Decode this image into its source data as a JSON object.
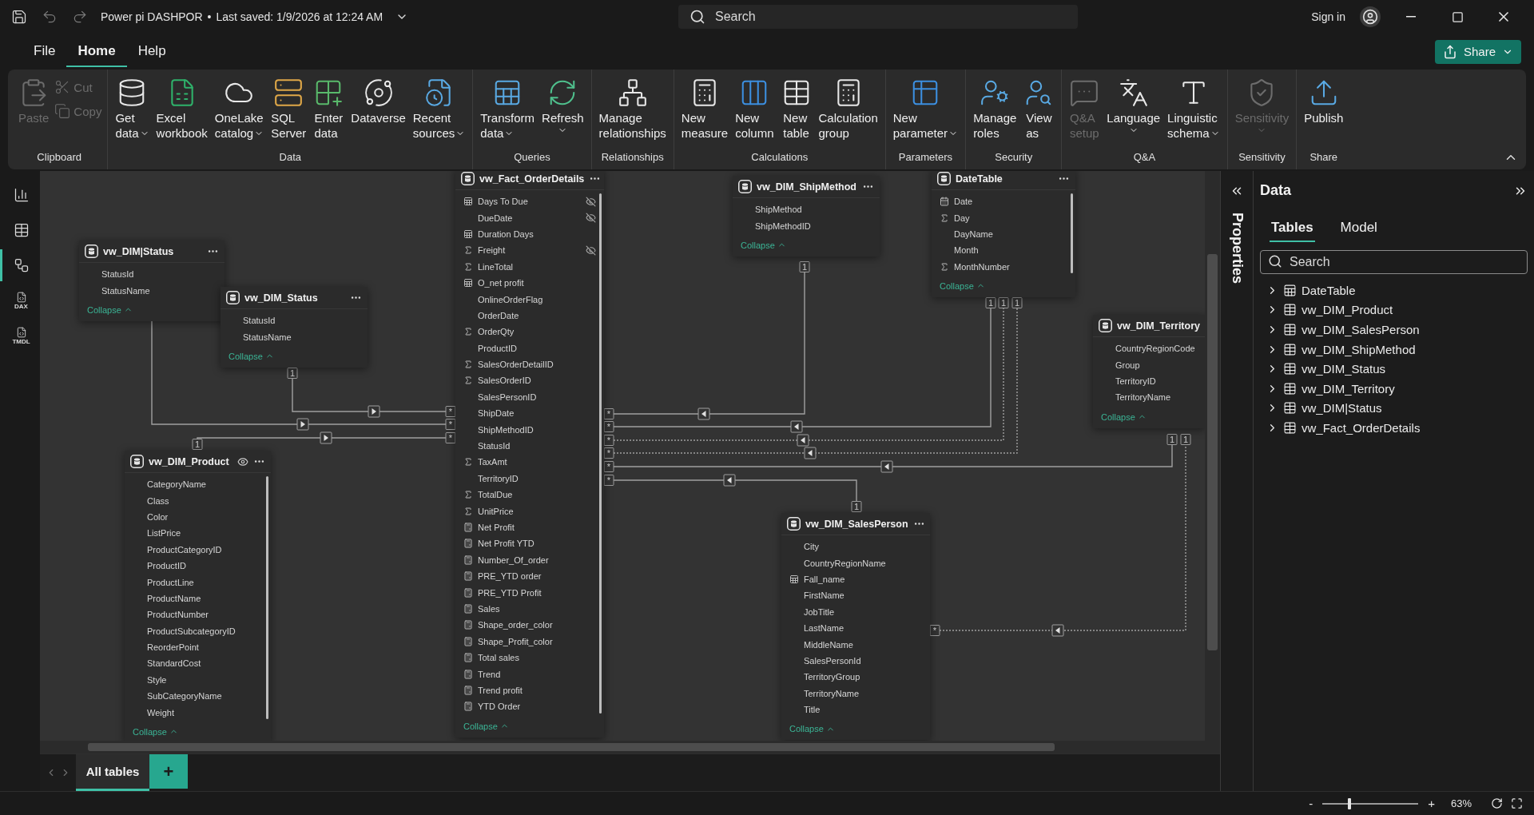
{
  "title_bar": {
    "title": "Power pi DASHPOR",
    "separator": "•",
    "saved": "Last saved: 1/9/2026 at 12:24 AM",
    "search": {
      "placeholder": "Search"
    },
    "sign_in": "Sign in"
  },
  "menu": {
    "items": [
      {
        "label": "File",
        "selected": false
      },
      {
        "label": "Home",
        "selected": true
      },
      {
        "label": "Help",
        "selected": false
      }
    ],
    "share": "Share"
  },
  "ribbon": {
    "groups": [
      {
        "label": "Clipboard",
        "buttons": [
          {
            "kind": "large",
            "lines": [
              "Paste"
            ],
            "dropdown": false,
            "disabled": true
          },
          {
            "kind": "small",
            "lines": [
              "Cut"
            ],
            "dropdown": false,
            "disabled": true
          },
          {
            "kind": "small",
            "lines": [
              "Copy"
            ],
            "dropdown": false,
            "disabled": true
          }
        ]
      },
      {
        "label": "Data",
        "buttons": [
          {
            "kind": "large",
            "lines": [
              "Get",
              "data"
            ],
            "dropdown": true,
            "disabled": false
          },
          {
            "kind": "large",
            "lines": [
              "Excel",
              "workbook"
            ],
            "dropdown": false,
            "disabled": false
          },
          {
            "kind": "large",
            "lines": [
              "OneLake",
              "catalog"
            ],
            "dropdown": true,
            "disabled": false
          },
          {
            "kind": "large",
            "lines": [
              "SQL",
              "Server"
            ],
            "dropdown": false,
            "disabled": false
          },
          {
            "kind": "large",
            "lines": [
              "Enter",
              "data"
            ],
            "dropdown": false,
            "disabled": false
          },
          {
            "kind": "large",
            "lines": [
              "Dataverse"
            ],
            "dropdown": false,
            "disabled": false
          },
          {
            "kind": "large",
            "lines": [
              "Recent",
              "sources"
            ],
            "dropdown": true,
            "disabled": false
          }
        ]
      },
      {
        "label": "Queries",
        "buttons": [
          {
            "kind": "large",
            "lines": [
              "Transform",
              "data"
            ],
            "dropdown": true,
            "disabled": false
          },
          {
            "kind": "large",
            "lines": [
              "Refresh"
            ],
            "dropdown": true,
            "disabled": false
          }
        ]
      },
      {
        "label": "Relationships",
        "buttons": [
          {
            "kind": "large",
            "lines": [
              "Manage",
              "relationships"
            ],
            "dropdown": false,
            "disabled": false
          }
        ]
      },
      {
        "label": "Calculations",
        "buttons": [
          {
            "kind": "large",
            "lines": [
              "New",
              "measure"
            ],
            "dropdown": false,
            "disabled": false
          },
          {
            "kind": "large",
            "lines": [
              "New",
              "column"
            ],
            "dropdown": false,
            "disabled": false
          },
          {
            "kind": "large",
            "lines": [
              "New",
              "table"
            ],
            "dropdown": false,
            "disabled": false
          },
          {
            "kind": "large",
            "lines": [
              "Calculation",
              "group"
            ],
            "dropdown": false,
            "disabled": false
          }
        ]
      },
      {
        "label": "Parameters",
        "buttons": [
          {
            "kind": "large",
            "lines": [
              "New",
              "parameter"
            ],
            "dropdown": true,
            "disabled": false
          }
        ]
      },
      {
        "label": "Security",
        "buttons": [
          {
            "kind": "large",
            "lines": [
              "Manage",
              "roles"
            ],
            "dropdown": false,
            "disabled": false
          },
          {
            "kind": "large",
            "lines": [
              "View",
              "as"
            ],
            "dropdown": false,
            "disabled": false
          }
        ]
      },
      {
        "label": "Q&A",
        "buttons": [
          {
            "kind": "large",
            "lines": [
              "Q&A",
              "setup"
            ],
            "dropdown": false,
            "disabled": true
          },
          {
            "kind": "large",
            "lines": [
              "Language"
            ],
            "dropdown": true,
            "disabled": false
          },
          {
            "kind": "large",
            "lines": [
              "Linguistic",
              "schema"
            ],
            "dropdown": true,
            "disabled": false
          }
        ]
      },
      {
        "label": "Sensitivity",
        "buttons": [
          {
            "kind": "large",
            "lines": [
              "Sensitivity"
            ],
            "dropdown": true,
            "disabled": true
          }
        ]
      },
      {
        "label": "Share",
        "buttons": [
          {
            "kind": "large",
            "lines": [
              "Publish"
            ],
            "dropdown": false,
            "disabled": false
          }
        ]
      }
    ]
  },
  "nav": [
    {
      "kind": "report",
      "selected": false
    },
    {
      "kind": "table",
      "selected": false
    },
    {
      "kind": "model",
      "selected": true
    },
    {
      "kind": "dax",
      "label": "DAX",
      "selected": false
    },
    {
      "kind": "tmdl",
      "label": "TMDL",
      "selected": false
    }
  ],
  "diagram": {
    "tables": [
      {
        "name": "vw_Fact_OrderDetails",
        "eye": false,
        "collapse": "Collapse",
        "fields": [
          {
            "name": "Days To Due",
            "kind": "calc_column",
            "hidden": true
          },
          {
            "name": "DueDate",
            "kind": "none",
            "hidden": true
          },
          {
            "name": "Duration Days",
            "kind": "calc_column",
            "hidden": false
          },
          {
            "name": "Freight",
            "kind": "sum",
            "hidden": true
          },
          {
            "name": "LineTotal",
            "kind": "sum",
            "hidden": false
          },
          {
            "name": "O_net profit",
            "kind": "calc_column",
            "hidden": false
          },
          {
            "name": "OnlineOrderFlag",
            "kind": "none",
            "hidden": false
          },
          {
            "name": "OrderDate",
            "kind": "none",
            "hidden": false
          },
          {
            "name": "OrderQty",
            "kind": "sum",
            "hidden": false
          },
          {
            "name": "ProductID",
            "kind": "none",
            "hidden": false
          },
          {
            "name": "SalesOrderDetailID",
            "kind": "sum",
            "hidden": false
          },
          {
            "name": "SalesOrderID",
            "kind": "sum",
            "hidden": false
          },
          {
            "name": "SalesPersonID",
            "kind": "none",
            "hidden": false
          },
          {
            "name": "ShipDate",
            "kind": "none",
            "hidden": false
          },
          {
            "name": "ShipMethodID",
            "kind": "none",
            "hidden": false
          },
          {
            "name": "StatusId",
            "kind": "none",
            "hidden": false
          },
          {
            "name": "TaxAmt",
            "kind": "sum",
            "hidden": false
          },
          {
            "name": "TerritoryID",
            "kind": "none",
            "hidden": false
          },
          {
            "name": "TotalDue",
            "kind": "sum",
            "hidden": false
          },
          {
            "name": "UnitPrice",
            "kind": "sum",
            "hidden": false
          },
          {
            "name": "Net Profit",
            "kind": "measure",
            "hidden": false
          },
          {
            "name": "Net Profit YTD",
            "kind": "measure",
            "hidden": false
          },
          {
            "name": "Number_Of_order",
            "kind": "measure",
            "hidden": false
          },
          {
            "name": "PRE_YTD order",
            "kind": "measure",
            "hidden": false
          },
          {
            "name": "PRE_YTD Profit",
            "kind": "measure",
            "hidden": false
          },
          {
            "name": "Sales",
            "kind": "measure",
            "hidden": false
          },
          {
            "name": "Shape_order_color",
            "kind": "measure",
            "hidden": false
          },
          {
            "name": "Shape_Profit_color",
            "kind": "measure",
            "hidden": false
          },
          {
            "name": "Total sales",
            "kind": "measure",
            "hidden": false
          },
          {
            "name": "Trend",
            "kind": "measure",
            "hidden": false
          },
          {
            "name": "Trend profit",
            "kind": "measure",
            "hidden": false
          },
          {
            "name": "YTD Order",
            "kind": "measure",
            "hidden": false
          }
        ]
      },
      {
        "name": "vw_DIM_ShipMethod",
        "eye": false,
        "collapse": "Collapse",
        "fields": [
          {
            "name": "ShipMethod",
            "kind": "none"
          },
          {
            "name": "ShipMethodID",
            "kind": "none"
          }
        ]
      },
      {
        "name": "DateTable",
        "eye": false,
        "collapse": "Collapse",
        "fields": [
          {
            "name": "Date",
            "kind": "date"
          },
          {
            "name": "Day",
            "kind": "sum"
          },
          {
            "name": "DayName",
            "kind": "none"
          },
          {
            "name": "Month",
            "kind": "none"
          },
          {
            "name": "MonthNumber",
            "kind": "sum"
          }
        ]
      },
      {
        "name": "vw_DIM|Status",
        "eye": false,
        "collapse": "Collapse",
        "fields": [
          {
            "name": "StatusId",
            "kind": "none"
          },
          {
            "name": "StatusName",
            "kind": "none"
          }
        ]
      },
      {
        "name": "vw_DIM_Status",
        "eye": false,
        "collapse": "Collapse",
        "fields": [
          {
            "name": "StatusId",
            "kind": "none"
          },
          {
            "name": "StatusName",
            "kind": "none"
          }
        ]
      },
      {
        "name": "vw_DIM_Territory",
        "eye": false,
        "collapse": "Collapse",
        "fields": [
          {
            "name": "CountryRegionCode",
            "kind": "none"
          },
          {
            "name": "Group",
            "kind": "none"
          },
          {
            "name": "TerritoryID",
            "kind": "none"
          },
          {
            "name": "TerritoryName",
            "kind": "none"
          }
        ]
      },
      {
        "name": "vw_DIM_Product",
        "eye": true,
        "collapse": "Collapse",
        "fields": [
          {
            "name": "CategoryName",
            "kind": "none"
          },
          {
            "name": "Class",
            "kind": "none"
          },
          {
            "name": "Color",
            "kind": "none"
          },
          {
            "name": "ListPrice",
            "kind": "none"
          },
          {
            "name": "ProductCategoryID",
            "kind": "none"
          },
          {
            "name": "ProductID",
            "kind": "none"
          },
          {
            "name": "ProductLine",
            "kind": "none"
          },
          {
            "name": "ProductName",
            "kind": "none"
          },
          {
            "name": "ProductNumber",
            "kind": "none"
          },
          {
            "name": "ProductSubcategoryID",
            "kind": "none"
          },
          {
            "name": "ReorderPoint",
            "kind": "none"
          },
          {
            "name": "StandardCost",
            "kind": "none"
          },
          {
            "name": "Style",
            "kind": "none"
          },
          {
            "name": "SubCategoryName",
            "kind": "none"
          },
          {
            "name": "Weight",
            "kind": "none"
          }
        ]
      },
      {
        "name": "vw_DIM_SalesPerson",
        "eye": false,
        "collapse": "Collapse",
        "fields": [
          {
            "name": "City",
            "kind": "none"
          },
          {
            "name": "CountryRegionName",
            "kind": "none"
          },
          {
            "name": "Fall_name",
            "kind": "calc_column"
          },
          {
            "name": "FirstName",
            "kind": "none"
          },
          {
            "name": "JobTitle",
            "kind": "none"
          },
          {
            "name": "LastName",
            "kind": "none"
          },
          {
            "name": "MiddleName",
            "kind": "none"
          },
          {
            "name": "SalesPersonId",
            "kind": "none"
          },
          {
            "name": "TerritoryGroup",
            "kind": "none"
          },
          {
            "name": "TerritoryName",
            "kind": "none"
          },
          {
            "name": "Title",
            "kind": "none"
          }
        ]
      }
    ],
    "relationships": [
      {
        "one": "1",
        "many": "*",
        "dashed": false
      },
      {
        "many": "*",
        "dashed": false
      },
      {
        "one": "1",
        "many": "*",
        "dashed": false
      },
      {
        "one": "1",
        "many": "*",
        "dashed": false
      },
      {
        "one": "1",
        "many": "*",
        "dashed": false
      },
      {
        "one": "1",
        "many": "*",
        "dashed": true
      },
      {
        "one": "1",
        "many": "*",
        "dashed": true
      },
      {
        "one": "1",
        "many": "*",
        "dashed": false
      },
      {
        "one": "1",
        "many": "*",
        "dashed": false
      },
      {
        "one": "1",
        "many": "*",
        "dashed": true
      }
    ]
  },
  "properties_label": "Properties",
  "data_pane": {
    "title": "Data",
    "tabs": [
      {
        "label": "Tables",
        "selected": true
      },
      {
        "label": "Model",
        "selected": false
      }
    ],
    "search": {
      "placeholder": "Search"
    },
    "tables": [
      {
        "name": "DateTable",
        "kind": "calc_table"
      },
      {
        "name": "vw_DIM_Product",
        "kind": "table"
      },
      {
        "name": "vw_DIM_SalesPerson",
        "kind": "table"
      },
      {
        "name": "vw_DIM_ShipMethod",
        "kind": "table"
      },
      {
        "name": "vw_DIM_Status",
        "kind": "table"
      },
      {
        "name": "vw_DIM_Territory",
        "kind": "table"
      },
      {
        "name": "vw_DIM|Status",
        "kind": "table"
      },
      {
        "name": "vw_Fact_OrderDetails",
        "kind": "table"
      }
    ]
  },
  "bottom_tabs": {
    "tabs": [
      {
        "label": "All tables",
        "selected": true
      }
    ],
    "add": "+"
  },
  "status_bar": {
    "zoom_out": "-",
    "zoom_in": "+",
    "zoom": {
      "level": 0.28
    },
    "reading": "63%"
  }
}
